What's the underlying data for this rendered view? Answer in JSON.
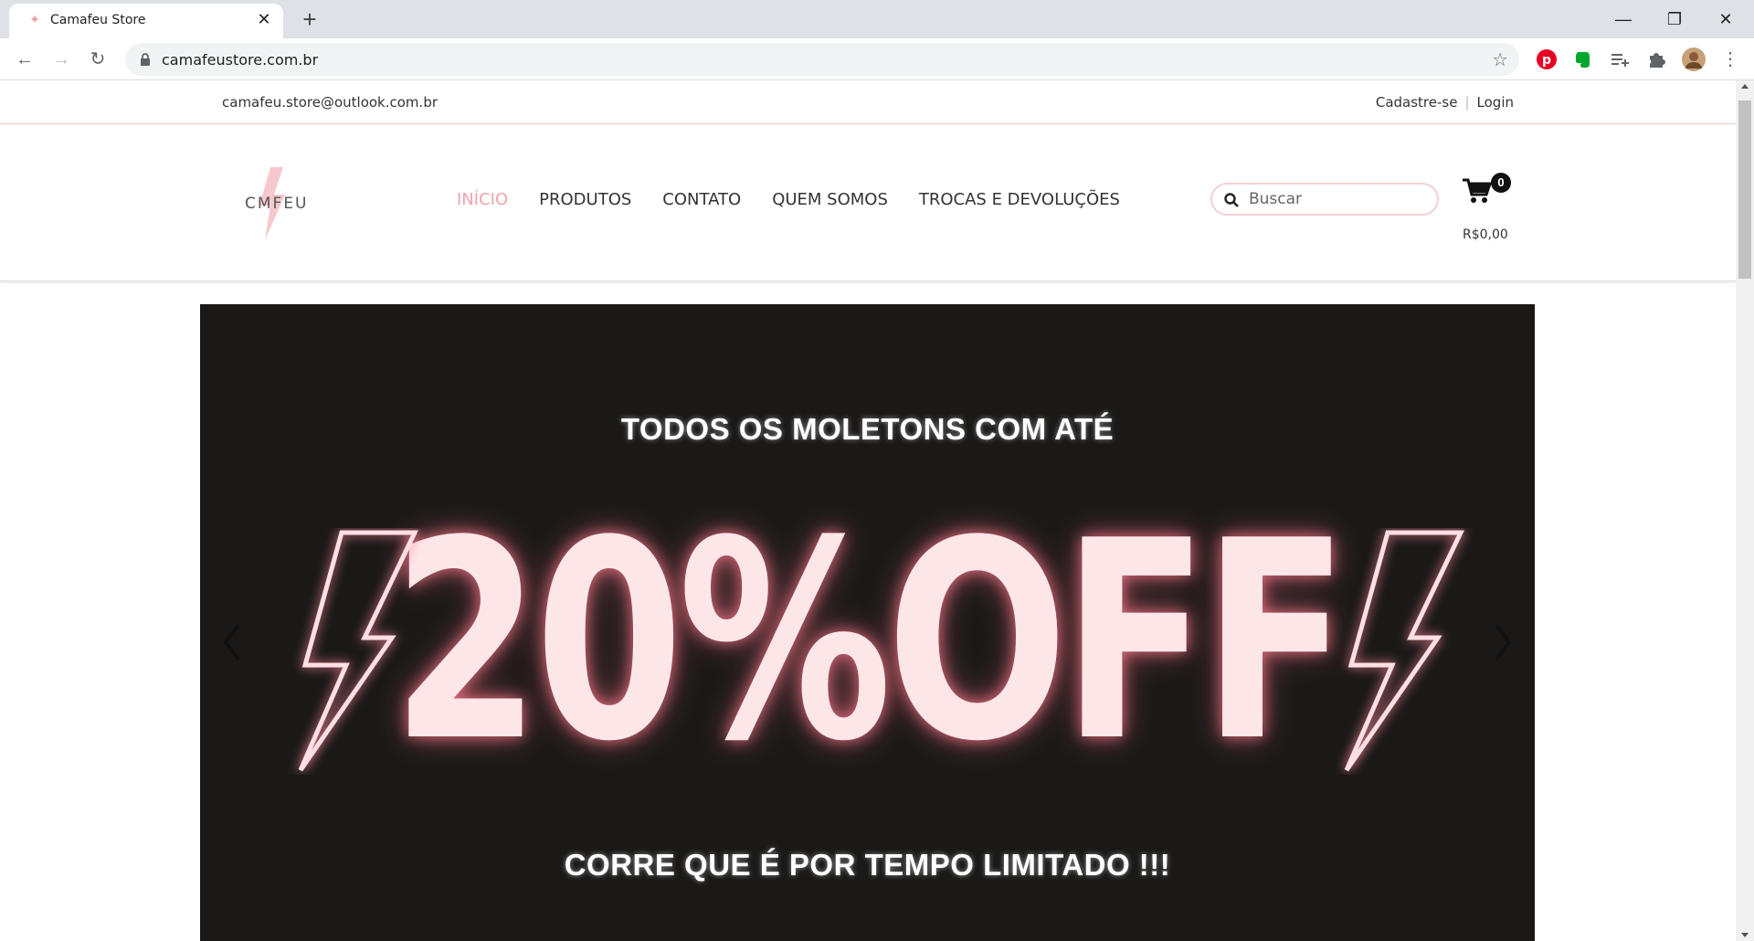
{
  "browser": {
    "tab_title": "Camafeu Store",
    "url": "camafeustore.com.br"
  },
  "topbar": {
    "email": "camafeu.store@outlook.com.br",
    "signup": "Cadastre-se",
    "login": "Login"
  },
  "header": {
    "logo_text": "CMFEU",
    "nav": [
      "INÍCIO",
      "PRODUTOS",
      "CONTATO",
      "QUEM SOMOS",
      "TROCAS E DEVOLUÇÕES"
    ],
    "search_placeholder": "Buscar",
    "cart_count": "0",
    "cart_total": "R$0,00"
  },
  "hero": {
    "top_text": "TODOS OS MOLETONS COM ATÉ",
    "big_text": "20%OFF",
    "bottom_text": "CORRE QUE É POR TEMPO LIMITADO !!!"
  },
  "colors": {
    "accent": "#efa3ae",
    "hero_bg": "#1b1918",
    "neon": "#fde6e8"
  }
}
